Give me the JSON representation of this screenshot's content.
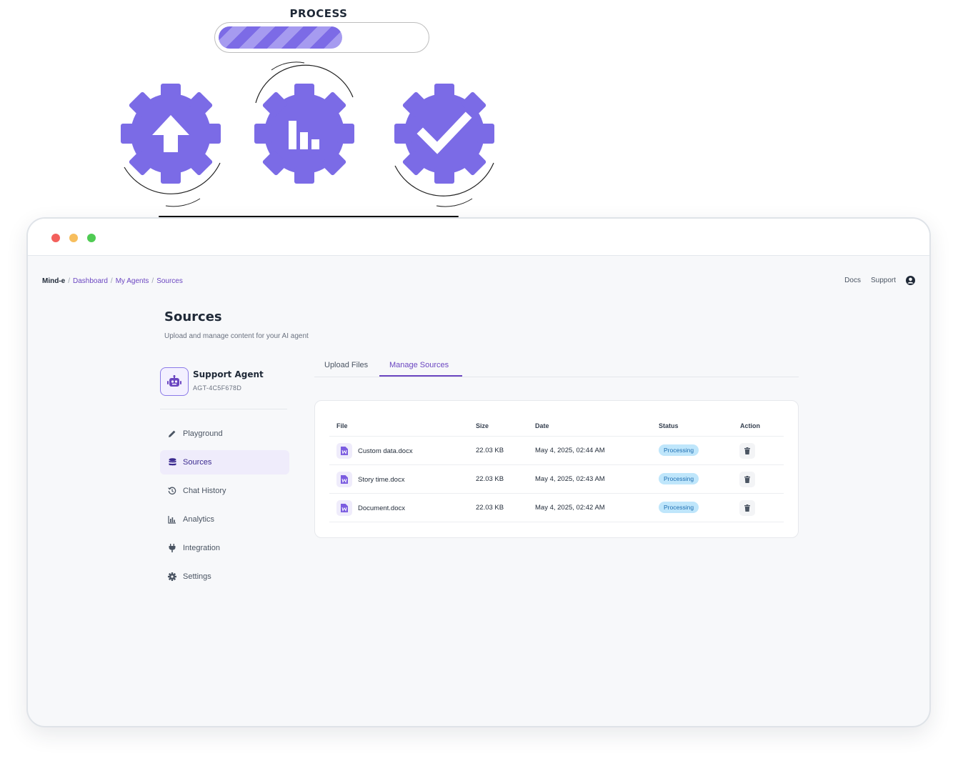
{
  "process": {
    "title": "PROCESS",
    "progress_percent": 60,
    "steps": [
      {
        "icon": "upload-arrow-icon"
      },
      {
        "icon": "bar-chart-icon"
      },
      {
        "icon": "checkmark-icon"
      }
    ],
    "accent_color": "#7b6be6"
  },
  "window": {
    "controls": [
      "close",
      "minimize",
      "maximize"
    ]
  },
  "breadcrumb": {
    "home": "Mind-e",
    "items": [
      "Dashboard",
      "My Agents",
      "Sources"
    ],
    "separator": "/"
  },
  "topnav": {
    "docs": "Docs",
    "support": "Support",
    "user_icon": "user-circle-icon"
  },
  "page": {
    "title": "Sources",
    "subtitle": "Upload and manage content for your AI agent"
  },
  "agent": {
    "name": "Support Agent",
    "id": "AGT-4C5F678D",
    "icon": "robot-icon"
  },
  "sidebar": {
    "items": [
      {
        "label": "Playground",
        "icon": "pencil-icon",
        "active": false
      },
      {
        "label": "Sources",
        "icon": "database-icon",
        "active": true
      },
      {
        "label": "Chat History",
        "icon": "history-icon",
        "active": false
      },
      {
        "label": "Analytics",
        "icon": "analytics-icon",
        "active": false
      },
      {
        "label": "Integration",
        "icon": "plug-icon",
        "active": false
      },
      {
        "label": "Settings",
        "icon": "gear-icon",
        "active": false
      }
    ]
  },
  "tabs": [
    {
      "label": "Upload Files",
      "active": false
    },
    {
      "label": "Manage Sources",
      "active": true
    }
  ],
  "table": {
    "headers": {
      "file": "File",
      "size": "Size",
      "date": "Date",
      "status": "Status",
      "action": "Action"
    },
    "rows": [
      {
        "file": "Custom data.docx",
        "size": "22.03 KB",
        "date": "May 4, 2025, 02:44 AM",
        "status": "Processing"
      },
      {
        "file": "Story time.docx",
        "size": "22.03 KB",
        "date": "May 4, 2025, 02:43 AM",
        "status": "Processing"
      },
      {
        "file": "Document.docx",
        "size": "22.03 KB",
        "date": "May 4, 2025, 02:42 AM",
        "status": "Processing"
      }
    ]
  }
}
